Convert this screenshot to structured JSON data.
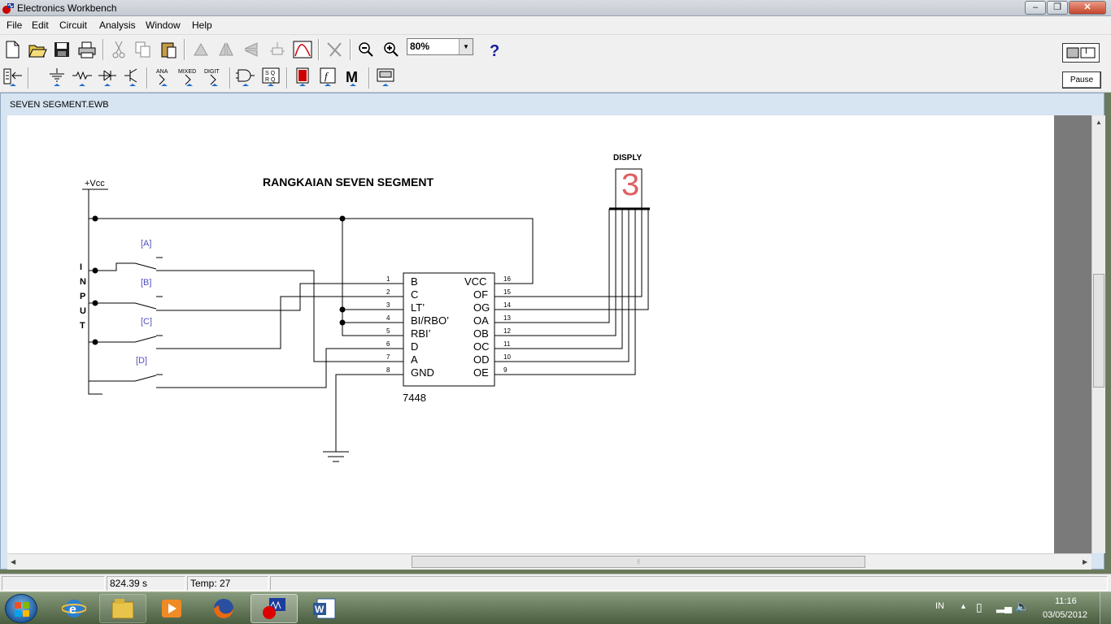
{
  "window": {
    "title": "Electronics Workbench"
  },
  "menu": [
    "File",
    "Edit",
    "Circuit",
    "Analysis",
    "Window",
    "Help"
  ],
  "toolbar": {
    "zoom_value": "80%",
    "pause_label": "Pause",
    "power_label": "I"
  },
  "document": {
    "title": "SEVEN SEGMENT.EWB"
  },
  "circuit": {
    "title": "RANGKAIAN SEVEN SEGMENT",
    "vcc_label": "+Vcc",
    "input_letters": [
      "I",
      "N",
      "P",
      "U",
      "T"
    ],
    "switch_labels": [
      "[A]",
      "[B]",
      "[C]",
      "[D]"
    ],
    "ic": {
      "name": "7448",
      "left_pins": [
        {
          "num": "1",
          "name": "B"
        },
        {
          "num": "2",
          "name": "C"
        },
        {
          "num": "3",
          "name": "LT’"
        },
        {
          "num": "4",
          "name": "BI/RBO’"
        },
        {
          "num": "5",
          "name": "RBI’"
        },
        {
          "num": "6",
          "name": "D"
        },
        {
          "num": "7",
          "name": "A"
        },
        {
          "num": "8",
          "name": "GND"
        }
      ],
      "right_pins": [
        {
          "num": "16",
          "name": "VCC"
        },
        {
          "num": "15",
          "name": "OF"
        },
        {
          "num": "14",
          "name": "OG"
        },
        {
          "num": "13",
          "name": "OA"
        },
        {
          "num": "12",
          "name": "OB"
        },
        {
          "num": "11",
          "name": "OC"
        },
        {
          "num": "10",
          "name": "OD"
        },
        {
          "num": "9",
          "name": "OE"
        }
      ]
    },
    "display": {
      "label": "DISPLY",
      "digit": "3",
      "color": "#e06060"
    }
  },
  "status": {
    "time": "824.39 s",
    "temp": "Temp:  27"
  },
  "taskbar": {
    "language": "IN",
    "clock_time": "11:16",
    "clock_date": "03/05/2012"
  }
}
